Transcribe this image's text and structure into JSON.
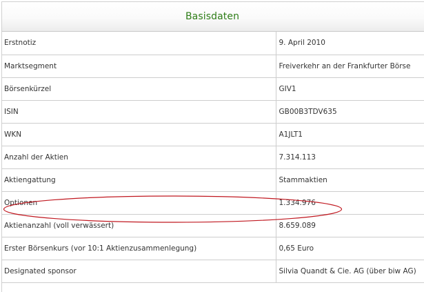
{
  "header": {
    "title": "Basisdaten"
  },
  "rows": [
    {
      "label": "Erstnotiz",
      "value": "9. April 2010"
    },
    {
      "label": "Marktsegment",
      "value": "Freiverkehr an der Frankfurter Börse"
    },
    {
      "label": "Börsenkürzel",
      "value": "GIV1"
    },
    {
      "label": "ISIN",
      "value": "GB00B3TDV635"
    },
    {
      "label": "WKN",
      "value": "A1JLT1"
    },
    {
      "label": "Anzahl der Aktien",
      "value": "7.314.113"
    },
    {
      "label": "Aktiengattung",
      "value": "Stammaktien"
    },
    {
      "label": "Optionen",
      "value": "1.334.976"
    },
    {
      "label": "Aktienanzahl (voll verwässert)",
      "value": "8.659.089"
    },
    {
      "label": "Erster Börsenkurs (vor 10:1 Aktienzusammenlegung)",
      "value": "0,65 Euro"
    },
    {
      "label": "Designated sponsor",
      "value": "Silvia Quandt & Cie. AG (über biw AG)"
    }
  ],
  "colors": {
    "title": "#2e7d17",
    "annotation": "#c0171f",
    "row_border": "#cdcdcd"
  }
}
